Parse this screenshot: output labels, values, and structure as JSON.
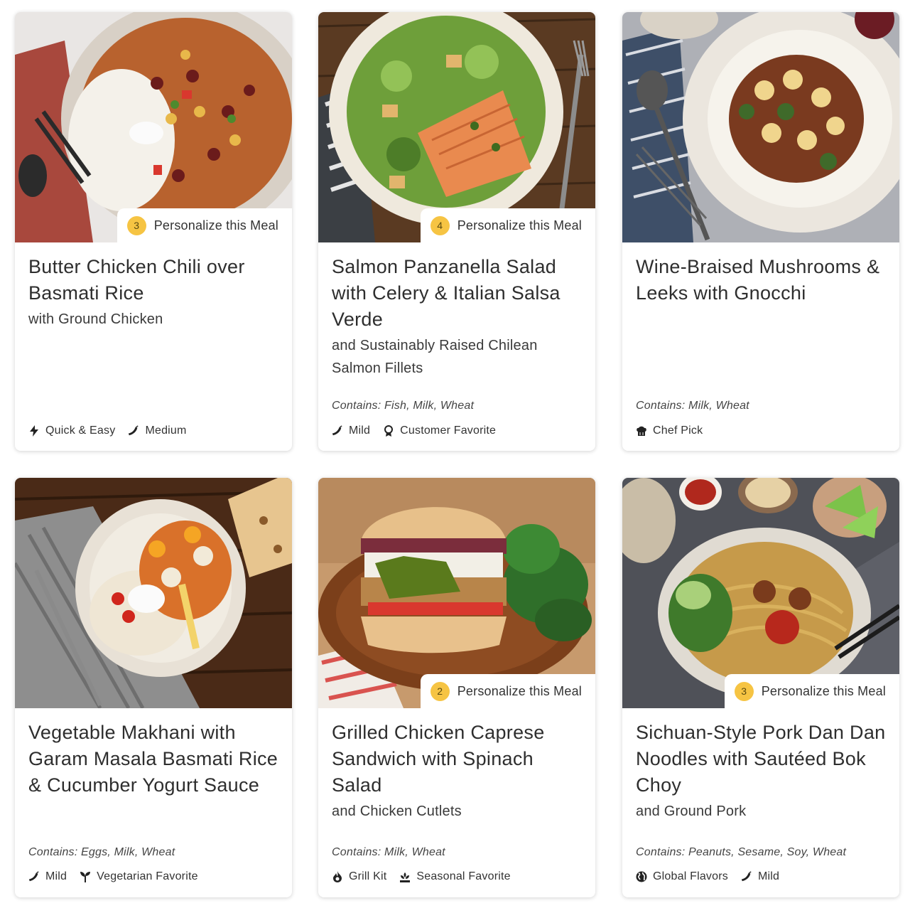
{
  "personalize_label": "Personalize this Meal",
  "meals": [
    {
      "title": "Butter Chicken Chili over Basmati Rice",
      "subtitle": "with Ground Chicken",
      "personalize_count": "3",
      "contains": "",
      "tags": [
        {
          "icon": "lightning-icon",
          "label": "Quick & Easy"
        },
        {
          "icon": "chili-pepper-icon",
          "label": "Medium"
        }
      ]
    },
    {
      "title": "Salmon Panzanella Salad with Celery & Italian Salsa Verde",
      "subtitle": "and Sustainably Raised Chilean Salmon Fillets",
      "personalize_count": "4",
      "contains": "Contains: Fish, Milk, Wheat",
      "tags": [
        {
          "icon": "chili-pepper-icon",
          "label": "Mild"
        },
        {
          "icon": "award-ribbon-icon",
          "label": "Customer Favorite"
        }
      ]
    },
    {
      "title": "Wine-Braised Mushrooms & Leeks with Gnocchi",
      "subtitle": "",
      "personalize_count": "",
      "contains": "Contains: Milk, Wheat",
      "tags": [
        {
          "icon": "chef-hat-icon",
          "label": "Chef Pick"
        }
      ]
    },
    {
      "title": "Vegetable Makhani with Garam Masala Basmati Rice & Cucumber Yogurt Sauce",
      "subtitle": "",
      "personalize_count": "",
      "contains": "Contains: Eggs, Milk, Wheat",
      "tags": [
        {
          "icon": "chili-pepper-icon",
          "label": "Mild"
        },
        {
          "icon": "sprout-icon",
          "label": "Vegetarian Favorite"
        }
      ]
    },
    {
      "title": "Grilled Chicken Caprese Sandwich with Spinach Salad",
      "subtitle": "and Chicken Cutlets",
      "personalize_count": "2",
      "contains": "Contains: Milk, Wheat",
      "tags": [
        {
          "icon": "flame-icon",
          "label": "Grill Kit"
        },
        {
          "icon": "seasonal-plant-icon",
          "label": "Seasonal Favorite"
        }
      ]
    },
    {
      "title": "Sichuan-Style Pork Dan Dan Noodles with Sautéed Bok Choy",
      "subtitle": "and Ground Pork",
      "personalize_count": "3",
      "contains": "Contains: Peanuts, Sesame, Soy, Wheat",
      "tags": [
        {
          "icon": "globe-icon",
          "label": "Global Flavors"
        },
        {
          "icon": "chili-pepper-icon",
          "label": "Mild"
        }
      ]
    }
  ],
  "colors": {
    "badge": "#f6c443",
    "text": "#2e2e2e"
  }
}
